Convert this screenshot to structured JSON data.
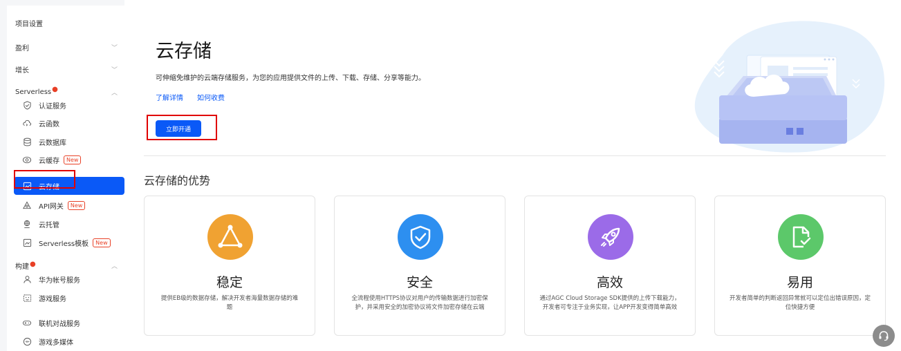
{
  "sidebar": {
    "project_settings": "项目设置",
    "sections": {
      "monetize": "盈利",
      "growth": "增长",
      "serverless": "Serverless",
      "build": "构建"
    },
    "serverless_items": [
      {
        "label": "认证服务",
        "icon": "shield-check-icon"
      },
      {
        "label": "云函数",
        "icon": "cloud-function-icon"
      },
      {
        "label": "云数据库",
        "icon": "database-icon"
      },
      {
        "label": "云缓存",
        "icon": "cache-icon",
        "badge": "New"
      },
      {
        "label": "云存储",
        "icon": "storage-icon",
        "active": true
      },
      {
        "label": "API网关",
        "icon": "api-gateway-icon",
        "badge": "New"
      },
      {
        "label": "云托管",
        "icon": "cloud-hosting-icon"
      },
      {
        "label": "Serverless模板",
        "icon": "template-icon",
        "badge": "New"
      }
    ],
    "build_items": [
      {
        "label": "华为帐号服务",
        "icon": "user-icon"
      },
      {
        "label": "游戏服务",
        "icon": "game-icon"
      },
      {
        "label": "联机对战服务",
        "icon": "gamepad-icon"
      },
      {
        "label": "游戏多媒体",
        "icon": "multimedia-icon"
      }
    ]
  },
  "main": {
    "title": "云存储",
    "description": "可伸缩免维护的云端存储服务，为您的应用提供文件的上传、下载、存储、分享等能力。",
    "link_details": "了解详情",
    "link_pricing": "如何收费",
    "open_button": "立即开通",
    "advantages_title": "云存储的优势",
    "cards": [
      {
        "title": "稳定",
        "desc": "提供EB级的数据存储，解决开发者海量数据存储的难题",
        "icon": "triangle-nodes-icon",
        "color": "#f0a232"
      },
      {
        "title": "安全",
        "desc": "全流程使用HTTPS协议对用户的传输数据进行加密保护，并采用安全的加密协议将文件加密存储在云端",
        "icon": "shield-check-icon",
        "color": "#2d8ff0"
      },
      {
        "title": "高效",
        "desc": "通过AGC Cloud Storage SDK提供的上传下载能力，开发者可专注于业务实现，让APP开发变得简单高效",
        "icon": "rocket-icon",
        "color": "#9b6be8"
      },
      {
        "title": "易用",
        "desc": "开发者简单的判断返回异常就可以定位出错误原因，定位快捷方便",
        "icon": "document-check-icon",
        "color": "#5cc86a"
      }
    ]
  },
  "colors": {
    "accent": "#0a59f7",
    "highlight": "#e00000",
    "badge": "#e84026"
  }
}
